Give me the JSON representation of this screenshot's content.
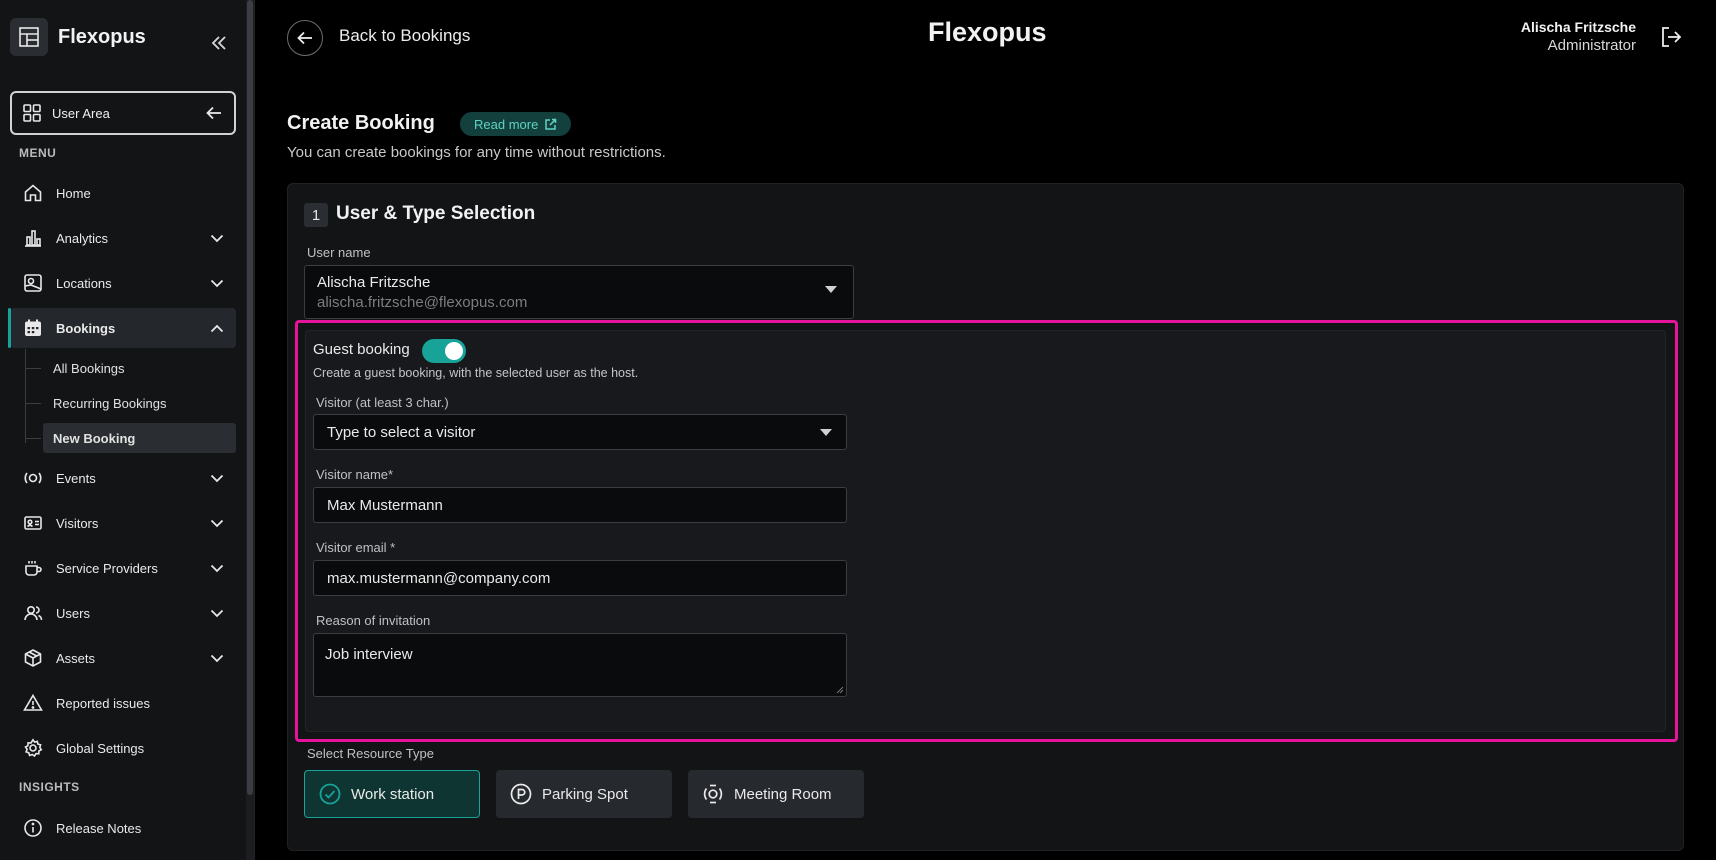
{
  "sidebar": {
    "brand": "Flexopus",
    "user_area": "User Area",
    "menu_label": "MENU",
    "insights_label": "INSIGHTS",
    "items": {
      "home": "Home",
      "analytics": "Analytics",
      "locations": "Locations",
      "bookings": "Bookings",
      "events": "Events",
      "visitors": "Visitors",
      "service_providers": "Service Providers",
      "users": "Users",
      "assets": "Assets",
      "reported_issues": "Reported issues",
      "global_settings": "Global Settings",
      "release_notes": "Release Notes"
    },
    "bookings_sub": {
      "all": "All Bookings",
      "recurring": "Recurring Bookings",
      "new": "New Booking"
    }
  },
  "header": {
    "back_label": "Back to Bookings",
    "app_title": "Flexopus",
    "user_name": "Alischa Fritzsche",
    "user_role": "Administrator"
  },
  "page": {
    "title": "Create Booking",
    "read_more": "Read more",
    "subtitle": "You can create bookings for any time without restrictions."
  },
  "section": {
    "step": "1",
    "title": "User & Type Selection",
    "user_name_label": "User name",
    "user_name_value": "Alischa Fritzsche",
    "user_email_value": "alischa.fritzsche@flexopus.com"
  },
  "guest": {
    "label": "Guest booking",
    "enabled": true,
    "help": "Create a guest booking, with the selected user as the host.",
    "visitor_label": "Visitor (at least 3 char.)",
    "visitor_placeholder": "Type to select a visitor",
    "visitor_name_label": "Visitor name*",
    "visitor_name_value": "Max Mustermann",
    "visitor_email_label": "Visitor email *",
    "visitor_email_value": "max.mustermann@company.com",
    "reason_label": "Reason of invitation",
    "reason_value": "Job interview"
  },
  "resource": {
    "label": "Select Resource Type",
    "options": [
      "Work station",
      "Parking Spot",
      "Meeting Room"
    ],
    "selected": "Work station"
  },
  "colors": {
    "accent": "#17a398",
    "highlight": "#e6139b",
    "background": "#000000",
    "panel": "#121416"
  }
}
